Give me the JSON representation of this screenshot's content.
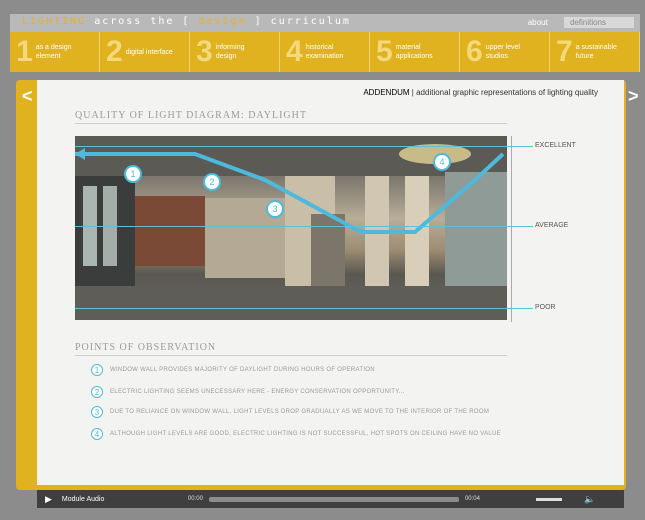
{
  "header": {
    "brand": {
      "w1": "LIGHTING",
      "w2": "across the [",
      "w3": "design",
      "w4": "] curriculum"
    },
    "links": {
      "about": "about",
      "definitions": "definitions"
    }
  },
  "nav": [
    {
      "num": "1",
      "label": "as a design element"
    },
    {
      "num": "2",
      "label": "digital interface"
    },
    {
      "num": "3",
      "label": "informing design"
    },
    {
      "num": "4",
      "label": "historical examination"
    },
    {
      "num": "5",
      "label": "material applications"
    },
    {
      "num": "6",
      "label": "upper level studios"
    },
    {
      "num": "7",
      "label": "a sustainable future"
    }
  ],
  "page": {
    "prev": "<",
    "next": ">",
    "addendum": "ADDENDUM",
    "addendum_sub": "| additional graphic representations of lighting quality",
    "diagram_title": "QUALITY OF LIGHT DIAGRAM: DAYLIGHT",
    "scale": {
      "excellent": "EXCELLENT",
      "average": "AVERAGE",
      "poor": "POOR"
    },
    "markers": [
      "1",
      "2",
      "3",
      "4"
    ],
    "obs_title": "POINTS OF OBSERVATION",
    "observations": [
      {
        "num": "1",
        "text": "WINDOW WALL PROVIDES MAJORITY OF DAYLIGHT DURING HOURS OF OPERATION"
      },
      {
        "num": "2",
        "text": "ELECTRIC LIGHTING SEEMS UNECESSARY HERE - ENERGY CONSERVATION OPPORTUNITY..."
      },
      {
        "num": "3",
        "text": "DUE TO RELIANCE ON WINDOW WALL, LIGHT LEVELS DROP GRADUALLY AS WE MOVE TO THE INTERIOR OF THE ROOM"
      },
      {
        "num": "4",
        "text": "ALTHOUGH LIGHT LEVELS ARE GOOD, ELECTRIC LIGHTING IS NOT SUCCESSFUL, HOT SPOTS ON CEILING HAVE NO VALUE"
      }
    ]
  },
  "player": {
    "label": "Module Audio",
    "start": "00:00",
    "end": "00:04"
  },
  "colors": {
    "accent": "#e1b21f",
    "line": "#4db9dd"
  }
}
